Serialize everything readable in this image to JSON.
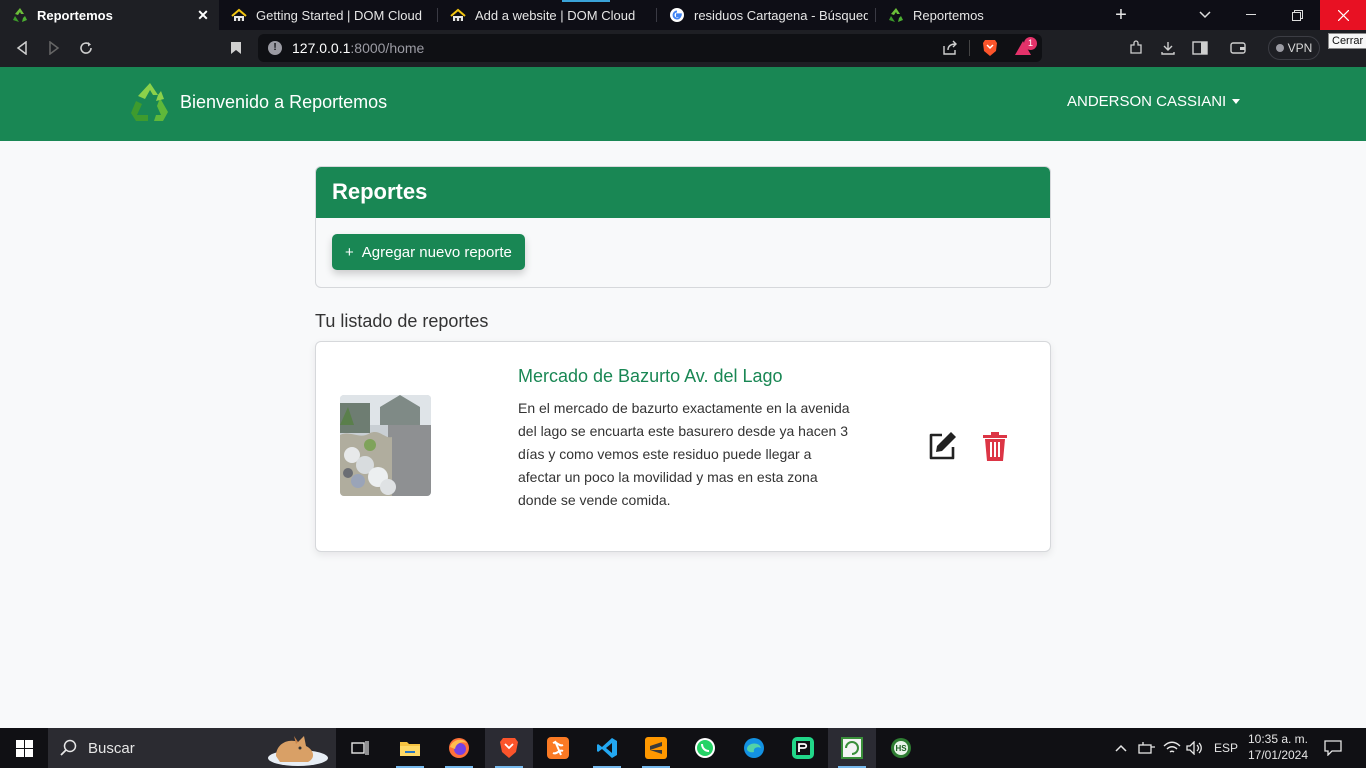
{
  "browser": {
    "tabs": [
      {
        "title": "Reportemos",
        "icon": "recycle-icon",
        "active": true
      },
      {
        "title": "Getting Started | DOM Cloud",
        "icon": "domcloud-icon"
      },
      {
        "title": "Add a website | DOM Cloud",
        "icon": "domcloud-icon"
      },
      {
        "title": "residuos Cartagena - Búsqueda de",
        "icon": "google-icon"
      },
      {
        "title": "Reportemos",
        "icon": "recycle-icon"
      }
    ],
    "url_host": "127.0.0.1",
    "url_rest": ":8000/home",
    "vpn_label": "VPN",
    "close_tooltip": "Cerrar",
    "shield_badge": "1"
  },
  "navbar": {
    "brand": "Bienvenido a Reportemos",
    "user": "ANDERSON CASSIANI"
  },
  "reports_panel": {
    "title": "Reportes",
    "add_button": "Agregar nuevo reporte"
  },
  "list_heading": "Tu listado de reportes",
  "reports": [
    {
      "title": "Mercado de Bazurto Av. del Lago",
      "description": "En el mercado de bazurto exactamente en la avenida del lago se encuarta este basurero desde ya hacen 3 días y como vemos este residuo puede llegar a afectar un poco la movilidad y mas en esta zona donde se vende comida."
    }
  ],
  "taskbar": {
    "search_placeholder": "Buscar",
    "language": "ESP",
    "time": "10:35 a. m.",
    "date": "17/01/2024"
  },
  "colors": {
    "brand_green": "#198754",
    "delete_red": "#dc3545"
  }
}
